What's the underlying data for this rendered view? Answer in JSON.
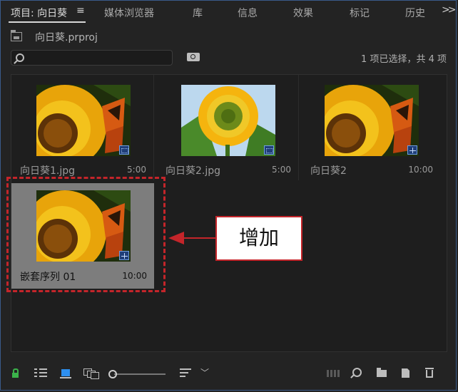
{
  "tabs": [
    {
      "label": "项目: 向日葵",
      "active": true
    },
    {
      "label": "媒体浏览器"
    },
    {
      "label": "库"
    },
    {
      "label": "信息"
    },
    {
      "label": "效果"
    },
    {
      "label": "标记"
    },
    {
      "label": "历史"
    }
  ],
  "tab_menu_icon": "hamburger-menu-icon",
  "overflow_icon": ">>",
  "project": {
    "name": "向日葵.prproj",
    "search_value": "",
    "status": "1 项已选择，共 4 项"
  },
  "items": [
    {
      "name": "向日葵1.jpg",
      "duration": "5:00",
      "kind": "image",
      "selected": false
    },
    {
      "name": "向日葵2.jpg",
      "duration": "5:00",
      "kind": "image",
      "selected": false
    },
    {
      "name": "向日葵2",
      "duration": "10:00",
      "kind": "sequence",
      "selected": false
    },
    {
      "name": "嵌套序列 01",
      "duration": "10:00",
      "kind": "sequence",
      "selected": true
    }
  ],
  "annotation": {
    "label": "增加",
    "color": "#c4252a"
  },
  "colors": {
    "accent": "#2d8ff0",
    "selection": "#7d7d7d",
    "lock": "#3bb24a"
  }
}
